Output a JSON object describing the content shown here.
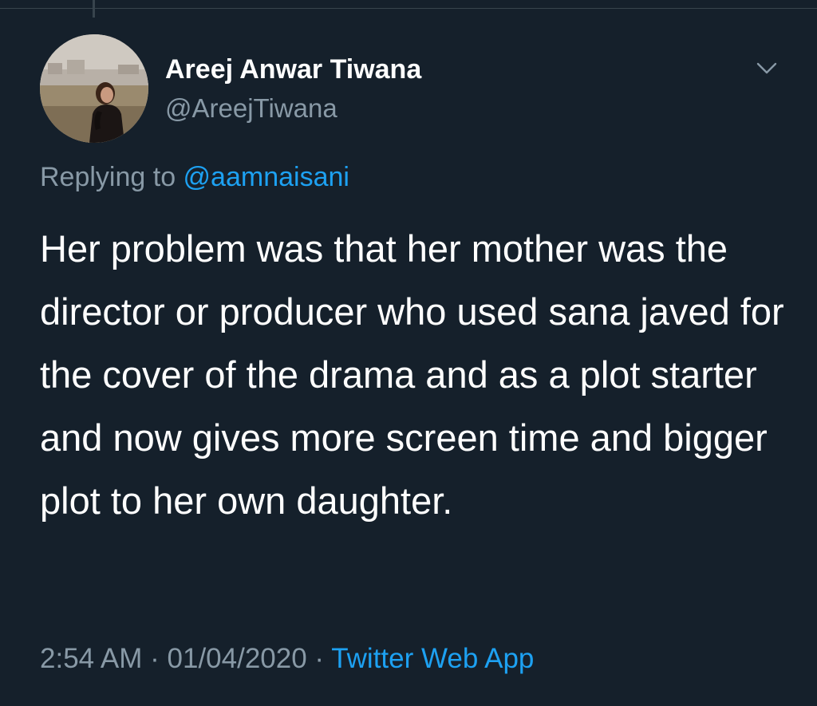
{
  "tweet": {
    "author": {
      "display_name": "Areej Anwar Tiwana",
      "handle": "@AreejTiwana"
    },
    "replying_to_prefix": "Replying to ",
    "replying_to_handle": "@aamnaisani",
    "text": "Her problem was that her mother was the director or producer who used sana javed for the cover of the drama and as a plot starter and now gives more screen time and bigger plot to her own daughter.",
    "time": "2:54 AM",
    "separator": " · ",
    "date": "01/04/2020",
    "source": "Twitter Web App"
  },
  "icons": {
    "menu": "chevron-down-icon",
    "avatar": "profile-photo"
  },
  "colors": {
    "background": "#15202b",
    "text_primary": "#ffffff",
    "text_secondary": "#8899a6",
    "accent": "#1da1f2",
    "divider": "#38444d"
  }
}
